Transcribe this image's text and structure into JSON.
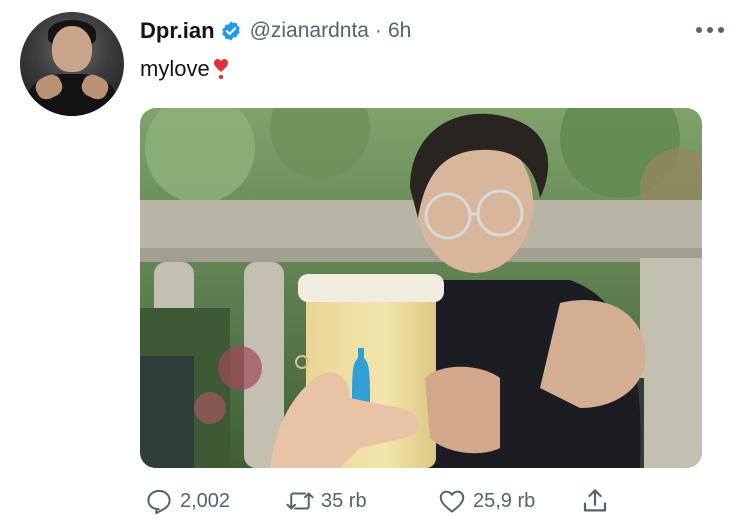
{
  "user": {
    "display_name": "Dpr.ian",
    "handle": "@zianardnta",
    "separator": "·",
    "time": "6h",
    "verified": true,
    "verified_color": "#1d9bf0"
  },
  "tweet": {
    "text": "mylove",
    "emoji": "heart-exclamation-emoji"
  },
  "actions": {
    "reply_count": "2,002",
    "retweet_count": "35 rb",
    "like_count": "25,9 rb"
  },
  "colors": {
    "text": "#0f1419",
    "secondary": "#536471"
  },
  "icons": [
    "more-icon",
    "verified-badge-icon",
    "reply-icon",
    "retweet-icon",
    "like-icon",
    "share-icon"
  ]
}
